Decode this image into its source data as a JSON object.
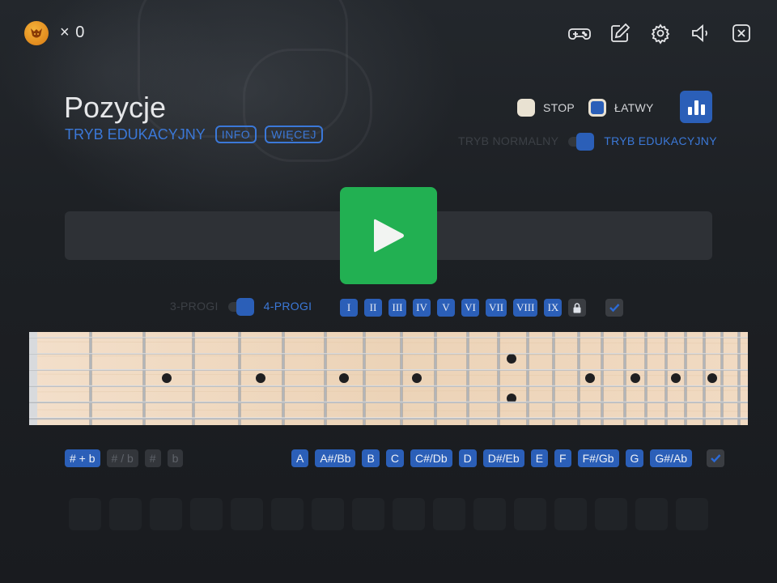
{
  "header": {
    "coin_icon": "fox-coin-icon",
    "count": "× 0",
    "icons": [
      "gamepad-icon",
      "edit-icon",
      "gear-icon",
      "volume-icon",
      "close-icon"
    ]
  },
  "title": "Pozycje",
  "subtitle": {
    "mode": "TRYB EDUKACYJNY",
    "info_label": "INFO",
    "more_label": "WIĘCEJ"
  },
  "options": {
    "stop_label": "STOP",
    "easy_label": "ŁATWY",
    "mode_off_label": "TRYB NORMALNY",
    "mode_on_label": "TRYB EDUKACYJNY",
    "mode_on": true
  },
  "frets": {
    "off_label": "3-PROGI",
    "on_label": "4-PROGI",
    "four_frets": true
  },
  "positions": [
    "I",
    "II",
    "III",
    "IV",
    "V",
    "VI",
    "VII",
    "VIII",
    "IX"
  ],
  "accidentals": [
    {
      "label": "# + b",
      "active": true
    },
    {
      "label": "# / b",
      "active": false
    },
    {
      "label": "#",
      "active": false
    },
    {
      "label": "b",
      "active": false
    }
  ],
  "notes": [
    "A",
    "A#/Bb",
    "B",
    "C",
    "C#/Db",
    "D",
    "D#/Eb",
    "E",
    "F",
    "F#/Gb",
    "G",
    "G#/Ab"
  ],
  "answer_slots": 16,
  "colors": {
    "accent": "#2b5fb8",
    "play": "#22b052",
    "background": "#1b1e22"
  }
}
